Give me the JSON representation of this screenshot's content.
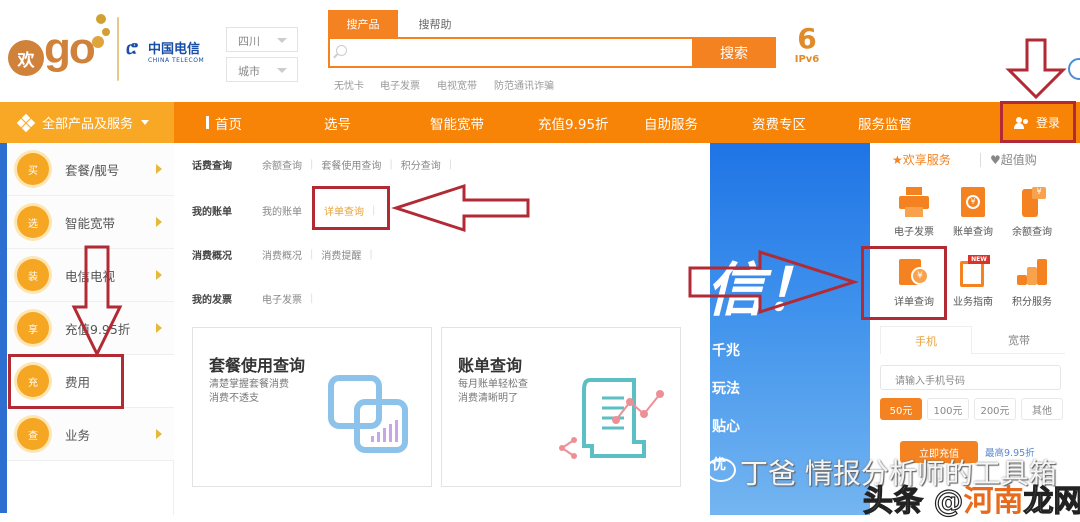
{
  "header": {
    "logo_char": "欢",
    "logo_text": "go",
    "telecom_cn": "中国电信",
    "telecom_en": "CHINA TELECOM",
    "province_select": "四川",
    "city_select": "城市",
    "search_tabs": [
      "搜产品",
      "搜帮助"
    ],
    "search_placeholder": "",
    "search_button": "搜索",
    "hot_keywords": [
      "无忧卡",
      "电子发票",
      "电视宽带",
      "防范通讯诈骗"
    ],
    "ipv6_label": "IPv6"
  },
  "nav": {
    "all_products": "全部产品及服务",
    "items": [
      "首页",
      "选号",
      "智能宽带",
      "充值9.95折",
      "自助服务",
      "资费专区",
      "服务监督"
    ],
    "login": "登录"
  },
  "left_menu": [
    {
      "badge": "买",
      "label": "套餐/靓号",
      "has_arrow": true
    },
    {
      "badge": "选",
      "label": "智能宽带",
      "has_arrow": true
    },
    {
      "badge": "装",
      "label": "电信电视",
      "has_arrow": true
    },
    {
      "badge": "享",
      "label": "充值9.95折",
      "has_arrow": true
    },
    {
      "badge": "充",
      "label": "费用",
      "has_arrow": false
    },
    {
      "badge": "查",
      "label": "业务",
      "has_arrow": true
    }
  ],
  "submenu": {
    "rows": [
      {
        "category": "话费查询",
        "links": [
          "余额查询",
          "套餐使用查询",
          "积分查询"
        ]
      },
      {
        "category": "我的账单",
        "links": [
          "我的账单",
          "详单查询"
        ],
        "highlighted": "详单查询"
      },
      {
        "category": "消费概况",
        "links": [
          "消费概况",
          "消费提醒"
        ]
      },
      {
        "category": "我的发票",
        "links": [
          "电子发票"
        ]
      }
    ],
    "cards": [
      {
        "title": "套餐使用查询",
        "desc_line1": "清楚掌握套餐消费",
        "desc_line2": "消费不透支"
      },
      {
        "title": "账单查询",
        "desc_line1": "每月账单轻松查",
        "desc_line2": "消费清晰明了"
      }
    ]
  },
  "banner": {
    "headline": "信！",
    "lines": [
      "千兆",
      "玩法",
      "贴心",
      "优"
    ]
  },
  "right_panel": {
    "tabs": [
      "欢享服务",
      "超值购"
    ],
    "services": [
      {
        "icon": "printer-icon",
        "label": "电子发票"
      },
      {
        "icon": "bill-book-icon",
        "label": "账单查询"
      },
      {
        "icon": "phone-balance-icon",
        "label": "余额查询"
      },
      {
        "icon": "detail-bill-yuan-icon",
        "label": "详单查询"
      },
      {
        "icon": "guide-new-icon",
        "label": "业务指南",
        "badge": "NEW"
      },
      {
        "icon": "points-coins-icon",
        "label": "积分服务"
      }
    ],
    "recharge_tabs": [
      "手机",
      "宽带"
    ],
    "phone_placeholder": "请输入手机号码",
    "amounts": [
      "50元",
      "100元",
      "200元",
      "其他"
    ],
    "selected_amount": "50元",
    "recharge_button": "立即充值",
    "promo": "最高9.95折"
  },
  "watermarks": {
    "line1": "丁爸 情报分析师的工具箱",
    "line2_prefix": "头条 @",
    "line2_highlight": "河南",
    "line2_suffix": "龙网录"
  },
  "colors": {
    "brand_orange": "#f78307",
    "annotation_red": "#b22a34",
    "banner_blue": "#1f74e6"
  }
}
